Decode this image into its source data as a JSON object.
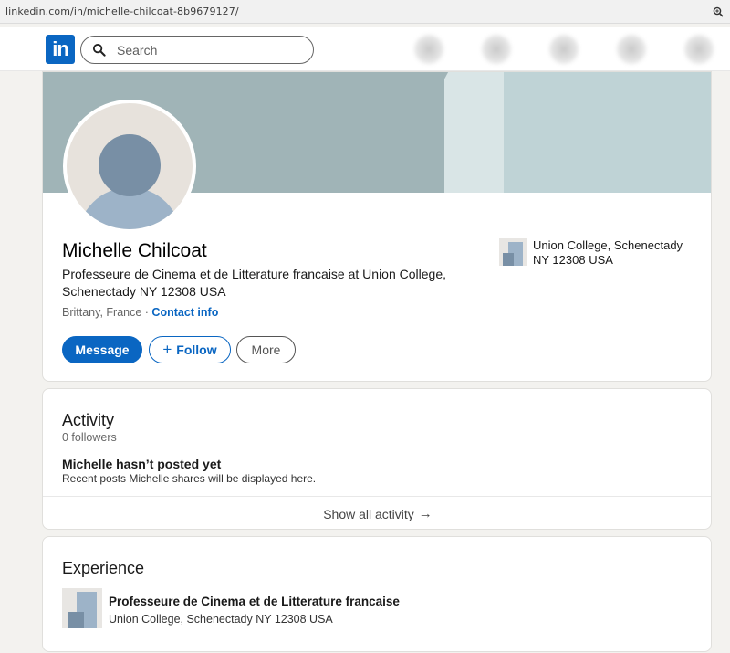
{
  "browser": {
    "url": "linkedin.com/in/michelle-chilcoat-8b9679127/"
  },
  "nav": {
    "logo_text": "in",
    "search_placeholder": "Search"
  },
  "profile": {
    "name": "Michelle Chilcoat",
    "headline": "Professeure de Cinema et de Litterature francaise at Union College, Schenectady NY 12308 USA",
    "location": "Brittany, France",
    "separator": " · ",
    "contact_info_label": "Contact info",
    "current_company": "Union College, Schenectady NY 12308 USA",
    "buttons": {
      "message": "Message",
      "follow_plus": "+",
      "follow": "Follow",
      "more": "More"
    }
  },
  "activity": {
    "title": "Activity",
    "followers": "0 followers",
    "empty_title": "Michelle hasn’t posted yet",
    "empty_subtitle": "Recent posts Michelle shares will be displayed here.",
    "show_all_label": "Show all activity",
    "show_all_arrow": "→"
  },
  "experience": {
    "title": "Experience",
    "items": [
      {
        "role": "Professeure de Cinema et de Litterature francaise",
        "company": "Union College, Schenectady NY 12308 USA"
      }
    ]
  },
  "colors": {
    "brand": "#0a66c2",
    "background": "#f3f2ef",
    "banner": "#a0b4b7"
  }
}
